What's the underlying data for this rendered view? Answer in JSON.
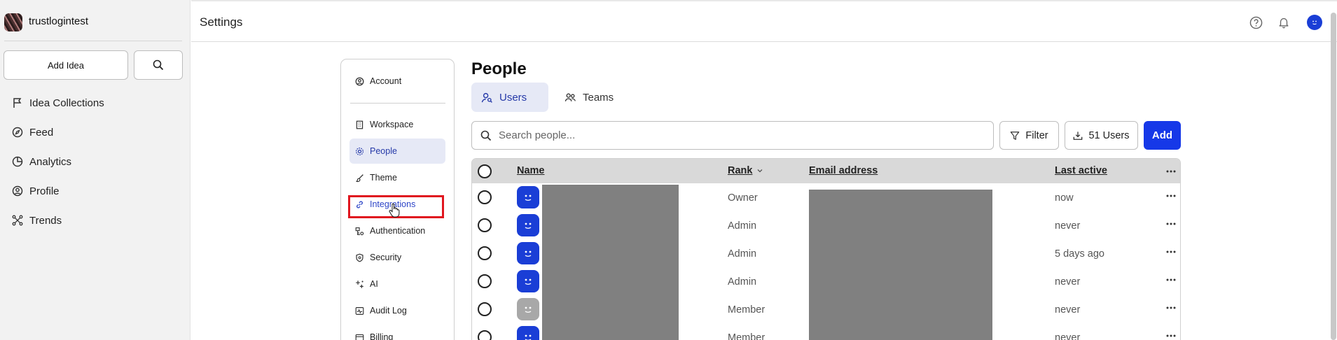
{
  "sidebar": {
    "workspace_name": "trustlogintest",
    "add_idea_label": "Add Idea",
    "items": [
      {
        "label": "Idea Collections",
        "icon": "flag-icon"
      },
      {
        "label": "Feed",
        "icon": "compass-icon"
      },
      {
        "label": "Analytics",
        "icon": "pie-chart-icon"
      },
      {
        "label": "Profile",
        "icon": "user-circle-icon"
      },
      {
        "label": "Trends",
        "icon": "network-icon"
      }
    ]
  },
  "header": {
    "title": "Settings"
  },
  "settings_nav": {
    "items": [
      {
        "label": "Account",
        "icon": "user-circle-icon"
      },
      {
        "label": "Workspace",
        "icon": "building-icon"
      },
      {
        "label": "People",
        "icon": "gear-people-icon",
        "active": true
      },
      {
        "label": "Theme",
        "icon": "brush-icon"
      },
      {
        "label": "Integrations",
        "icon": "link-icon",
        "hover": true
      },
      {
        "label": "Authentication",
        "icon": "key-icon"
      },
      {
        "label": "Security",
        "icon": "shield-icon"
      },
      {
        "label": "AI",
        "icon": "sparkle-icon"
      },
      {
        "label": "Audit Log",
        "icon": "activity-icon"
      },
      {
        "label": "Billing",
        "icon": "card-icon"
      }
    ]
  },
  "people": {
    "title": "People",
    "tabs": [
      {
        "label": "Users",
        "active": true
      },
      {
        "label": "Teams",
        "active": false
      }
    ],
    "search_placeholder": "Search people...",
    "filter_label": "Filter",
    "export_label": "51 Users",
    "add_label": "Add",
    "columns": {
      "name": "Name",
      "rank": "Rank",
      "email": "Email address",
      "last_active": "Last active"
    },
    "rows": [
      {
        "rank": "Owner",
        "last_active": "now",
        "avatar": "blue"
      },
      {
        "rank": "Admin",
        "last_active": "never",
        "avatar": "blue"
      },
      {
        "rank": "Admin",
        "last_active": "5 days ago",
        "avatar": "blue"
      },
      {
        "rank": "Admin",
        "last_active": "never",
        "avatar": "blue"
      },
      {
        "rank": "Member",
        "last_active": "never",
        "avatar": "grey"
      },
      {
        "rank": "Member",
        "last_active": "never",
        "avatar": "blue"
      }
    ]
  },
  "colors": {
    "accent": "#1638e8",
    "active_bg": "#e6e9f6",
    "highlight": "#e0161f",
    "redaction": "#808080"
  }
}
